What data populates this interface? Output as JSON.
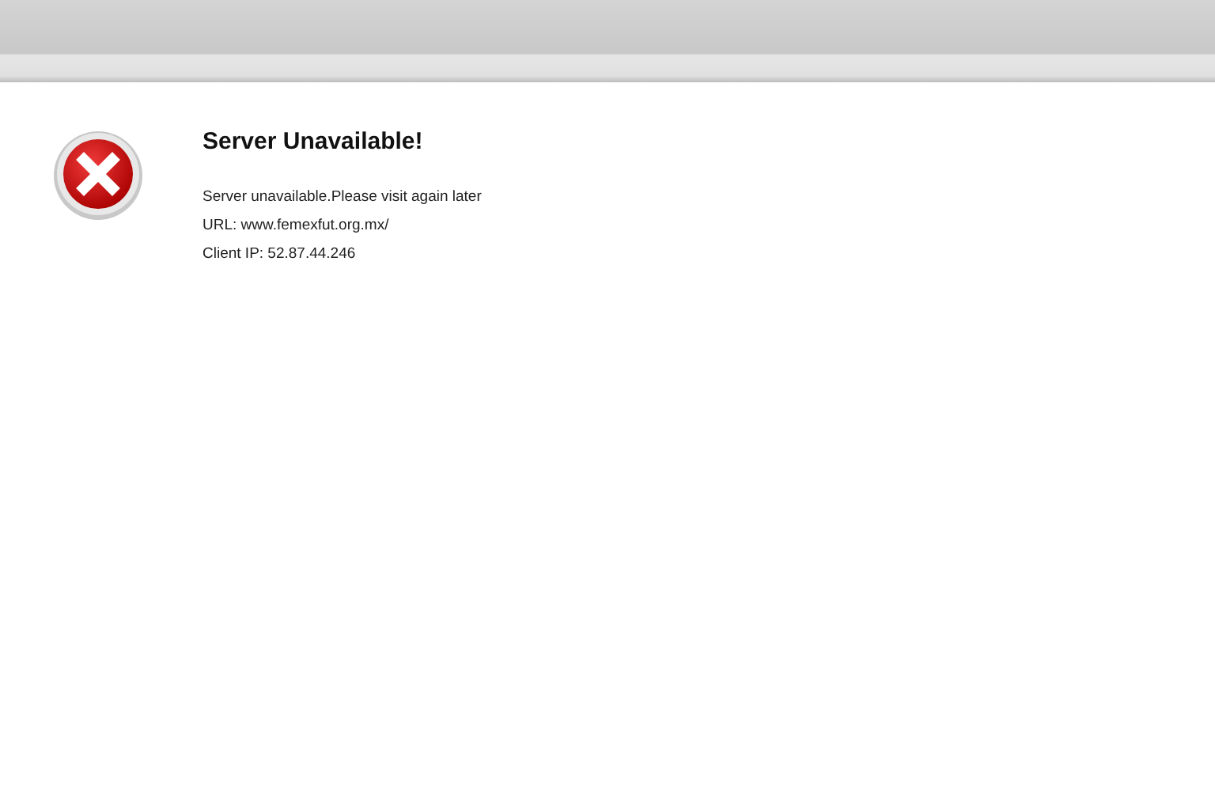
{
  "title": "Server Unavailable!",
  "lines": [
    "Server unavailable.Please visit again later",
    "URL: www.femexfut.org.mx/",
    "Client IP: 52.87.44.246"
  ]
}
